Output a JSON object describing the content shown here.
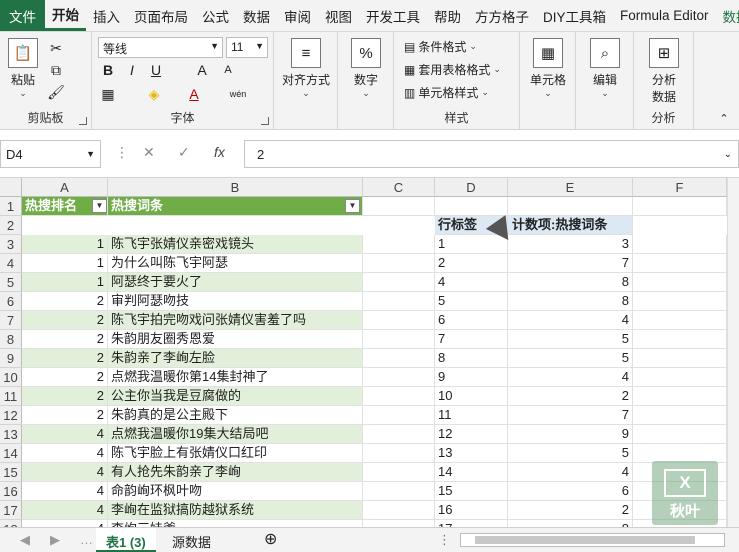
{
  "tabs": [
    "文件",
    "开始",
    "插入",
    "页面布局",
    "公式",
    "数据",
    "审阅",
    "视图",
    "开发工具",
    "帮助",
    "方方格子",
    "DIY工具箱",
    "Formula Editor",
    "数据"
  ],
  "ribbon": {
    "clipboard": {
      "paste": "粘贴",
      "label": "剪贴板"
    },
    "font": {
      "name": "等线",
      "size": "11",
      "label": "字体",
      "bold": "B",
      "italic": "I",
      "underline": "U",
      "grow": "A",
      "shrink": "A",
      "font_color": "A",
      "phonetic": "wén"
    },
    "align": {
      "label": "对齐方式"
    },
    "number": {
      "label": "数字",
      "symbol": "%"
    },
    "styles": {
      "cond": "条件格式",
      "table": "套用表格格式",
      "cell": "单元格样式",
      "label": "样式"
    },
    "cells": {
      "label": "单元格"
    },
    "edit": {
      "label": "编辑"
    },
    "analysis": {
      "btn1": "分析",
      "btn2": "数据",
      "label": "分析"
    }
  },
  "formula_bar": {
    "name_box": "D4",
    "value": "2",
    "fx": "fx"
  },
  "columns": [
    "A",
    "B",
    "C",
    "D",
    "E",
    "F"
  ],
  "rows": [
    "1",
    "2",
    "3",
    "4",
    "5",
    "6",
    "7",
    "8",
    "9",
    "10",
    "11",
    "12",
    "13",
    "14",
    "15",
    "16",
    "17",
    "18"
  ],
  "header": {
    "a": "热搜排名",
    "b": "热搜词条",
    "d": "行标签",
    "e": "计数项:热搜词条"
  },
  "data": [
    {
      "a": "1",
      "b": "陈飞宇张婧仪亲密戏镜头",
      "d": "1",
      "e": "3"
    },
    {
      "a": "1",
      "b": "为什么叫陈飞宇阿瑟",
      "d": "2",
      "e": "7"
    },
    {
      "a": "1",
      "b": "阿瑟终于要火了",
      "d": "4",
      "e": "8"
    },
    {
      "a": "2",
      "b": "审判阿瑟吻技",
      "d": "5",
      "e": "8"
    },
    {
      "a": "2",
      "b": "陈飞宇拍完吻戏问张婧仪害羞了吗",
      "d": "6",
      "e": "4"
    },
    {
      "a": "2",
      "b": "朱韵朋友圈秀恩爱",
      "d": "7",
      "e": "5"
    },
    {
      "a": "2",
      "b": "朱韵亲了李峋左脸",
      "d": "8",
      "e": "5"
    },
    {
      "a": "2",
      "b": "点燃我温暖你第14集封神了",
      "d": "9",
      "e": "4"
    },
    {
      "a": "2",
      "b": "公主你当我是豆腐做的",
      "d": "10",
      "e": "2"
    },
    {
      "a": "2",
      "b": "朱韵真的是公主殿下",
      "d": "11",
      "e": "7"
    },
    {
      "a": "4",
      "b": "点燃我温暖你19集大结局吧",
      "d": "12",
      "e": "9"
    },
    {
      "a": "4",
      "b": "陈飞宇脸上有张婧仪口红印",
      "d": "13",
      "e": "5"
    },
    {
      "a": "4",
      "b": "有人抢先朱韵亲了李峋",
      "d": "14",
      "e": "4"
    },
    {
      "a": "4",
      "b": "命韵峋环枫叶吻",
      "d": "15",
      "e": "6"
    },
    {
      "a": "4",
      "b": "李峋在监狱搞防越狱系统",
      "d": "16",
      "e": "2"
    },
    {
      "a": "4",
      "b": "李峋三娃爹",
      "d": "17",
      "e": "8"
    }
  ],
  "sheets": {
    "active": "表1 (3)",
    "other": "源数据"
  },
  "watermark": "秋叶"
}
